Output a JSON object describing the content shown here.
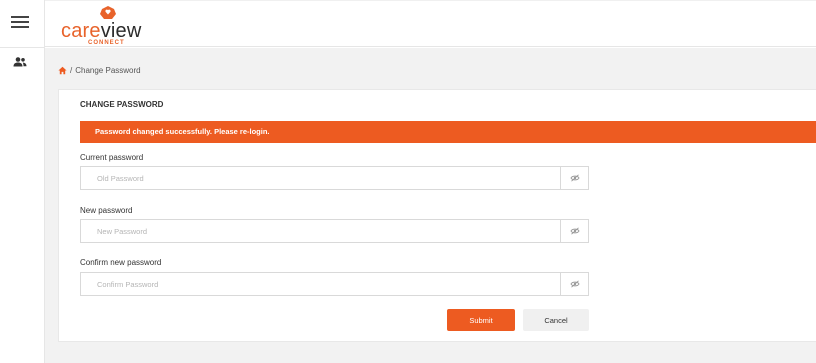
{
  "brand": {
    "name_part1": "care",
    "name_part2": "view",
    "tagline": "CONNECT",
    "accent_color": "#ed5b21"
  },
  "sidebar": {
    "items": [
      {
        "icon": "hamburger-menu-icon"
      },
      {
        "icon": "users-icon"
      }
    ]
  },
  "breadcrumb": {
    "home_icon": "home-icon",
    "separator": "/",
    "current": "Change Password"
  },
  "form": {
    "title": "CHANGE PASSWORD",
    "alert": "Password changed successfully. Please re-login.",
    "fields": [
      {
        "label": "Current password",
        "placeholder": "Old Password",
        "value": ""
      },
      {
        "label": "New password",
        "placeholder": "New Password",
        "value": ""
      },
      {
        "label": "Confirm new password",
        "placeholder": "Confirm Password",
        "value": ""
      }
    ],
    "submit_label": "Submit",
    "cancel_label": "Cancel"
  }
}
